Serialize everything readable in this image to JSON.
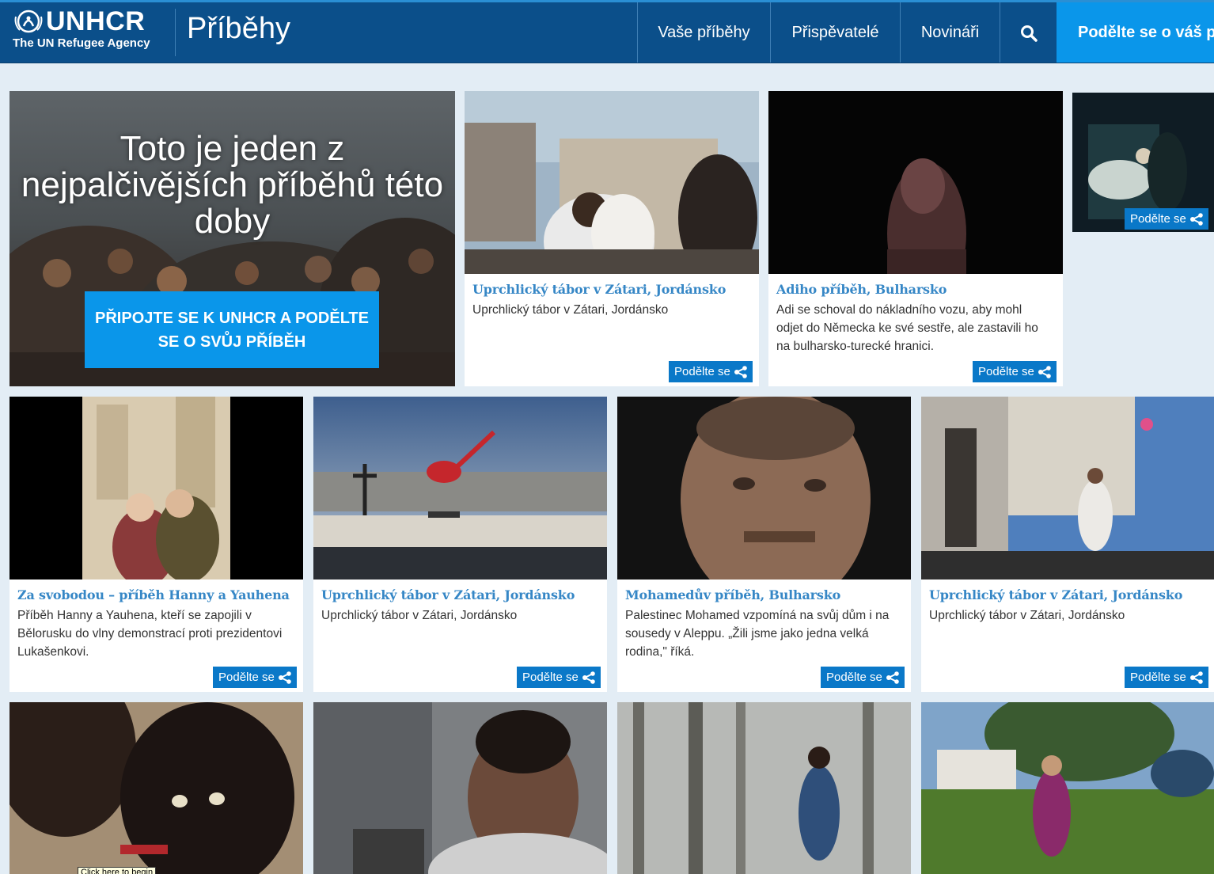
{
  "header": {
    "brand": "UNHCR",
    "agency": "The UN Refugee Agency",
    "site_title": "Příběhy",
    "nav": [
      "Vaše příběhy",
      "Přispěvatelé",
      "Novináři"
    ],
    "share_cta": "Podělte se o váš p"
  },
  "hero": {
    "title": "Toto je jeden z nejpalčivějších příběhů této doby",
    "button": "PŘIPOJTE SE K UNHCR A PODĚLTE SE O SVŮJ PŘÍBĚH"
  },
  "share_label": "Podělte se",
  "cards": [
    {
      "title": "Uprchlický tábor v Zátari, Jordánsko",
      "text": "Uprchlický tábor v Zátari, Jordánsko"
    },
    {
      "title": "Adiho příběh, Bulharsko",
      "text": "Adi se schoval do nákladního vozu, aby mohl odjet do Německa ke své sestře, ale zastavili ho na bulharsko-turecké hranici."
    },
    {
      "title": "Za svobodou – příběh Hanny a Yauhena",
      "text": "Příběh Hanny a Yauhena, kteří se zapojili v Bělorusku do vlny demonstrací proti prezidentovi Lukašenkovi."
    },
    {
      "title": "Uprchlický tábor v Zátari, Jordánsko",
      "text": "Uprchlický tábor v Zátari, Jordánsko"
    },
    {
      "title": "Mohamedův příběh, Bulharsko",
      "text": "Palestinec Mohamed vzpomíná na svůj dům i na sousedy v Aleppu. „Žili jsme jako jedna velká rodina,\" říká."
    },
    {
      "title": "Uprchlický tábor v Zátari, Jordánsko",
      "text": "Uprchlický tábor v Zátari, Jordánsko"
    }
  ],
  "tooltip": "Click here to begin"
}
